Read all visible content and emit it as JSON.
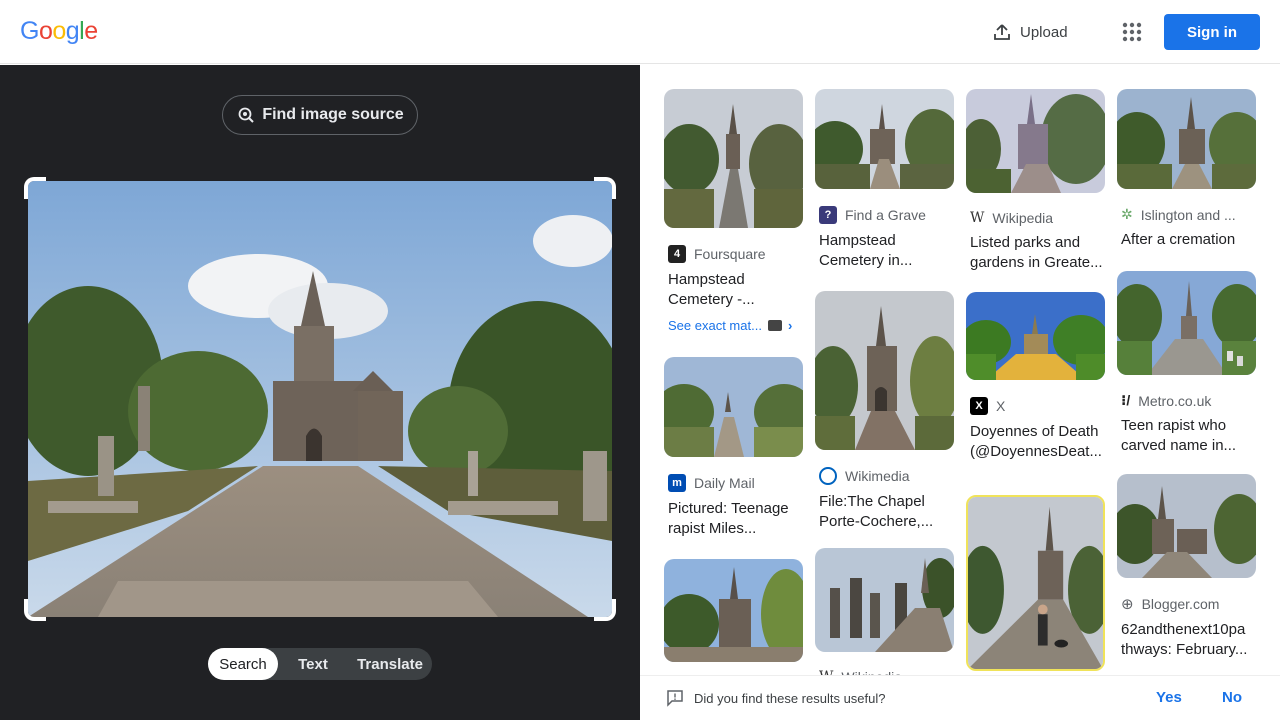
{
  "header": {
    "logo_letters": [
      {
        "ch": "G",
        "color": "#4285F4"
      },
      {
        "ch": "o",
        "color": "#EA4335"
      },
      {
        "ch": "o",
        "color": "#FBBC05"
      },
      {
        "ch": "g",
        "color": "#4285F4"
      },
      {
        "ch": "l",
        "color": "#34A853"
      },
      {
        "ch": "e",
        "color": "#EA4335"
      }
    ],
    "upload_label": "Upload",
    "apps_icon": "apps-grid-icon",
    "signin_label": "Sign in",
    "accent": "#1a73e8"
  },
  "lens": {
    "find_source_label": "Find image source",
    "modes": [
      "Search",
      "Text",
      "Translate"
    ],
    "active_mode": "Search"
  },
  "results": [
    {
      "source": "Foursquare",
      "title": "Hampstead Cemetery -...",
      "exact_match": "See exact mat..."
    },
    {
      "source": "Daily Mail",
      "title": "Pictured: Teenage rapist Miles..."
    },
    {
      "source": "Find a Grave",
      "title": "Hampstead Cemetery in..."
    },
    {
      "source": "Wikimedia",
      "title": "File:The Chapel Porte-Cochere,..."
    },
    {
      "source": "Wikipedia",
      "title": "Listed parks and gardens in Greate..."
    },
    {
      "source": "X",
      "title": "Doyennes of Death (@DoyennesDeat..."
    },
    {
      "source": "Islington and ...",
      "title": "After a cremation"
    },
    {
      "source": "Metro.co.uk",
      "title": "Teen rapist who carved name in..."
    },
    {
      "source": "Blogger.com",
      "title": "62andthenext10pa thways: February..."
    }
  ],
  "footer": {
    "question": "Did you find these results useful?",
    "yes": "Yes",
    "no": "No"
  }
}
